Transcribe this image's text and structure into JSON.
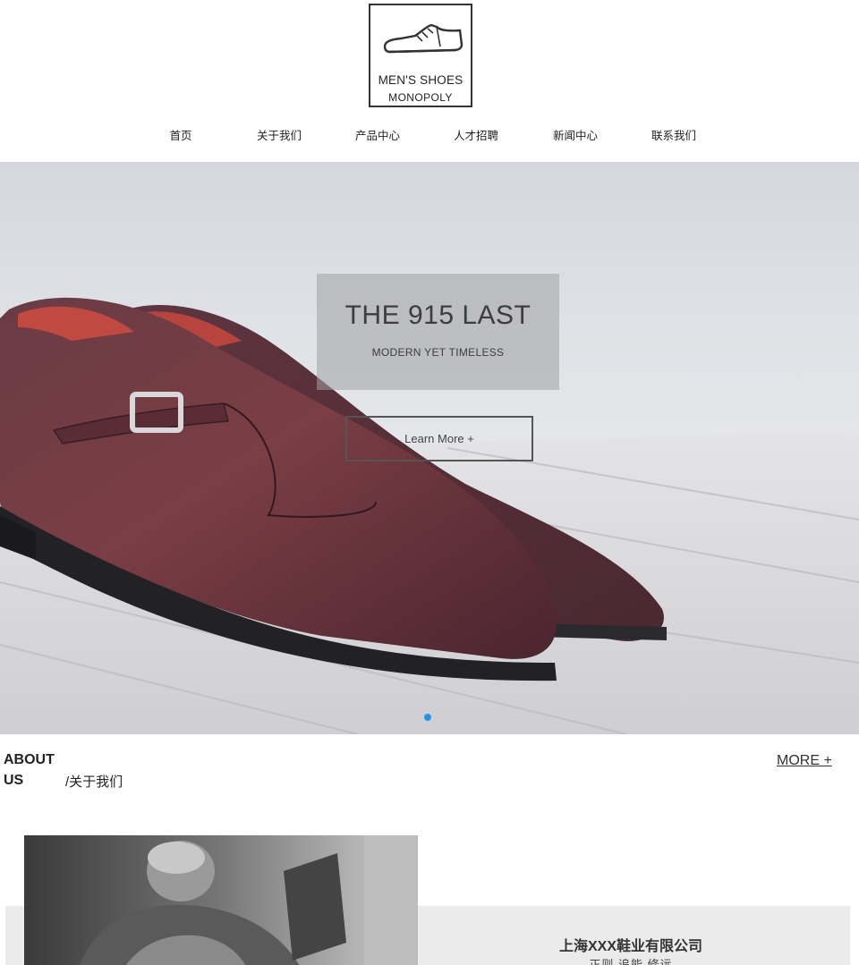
{
  "logo": {
    "line1": "MEN'S SHOES",
    "line2": "MONOPOLY"
  },
  "nav": {
    "items": [
      {
        "label": "首页"
      },
      {
        "label": "关于我们"
      },
      {
        "label": "产品中心"
      },
      {
        "label": "人才招聘"
      },
      {
        "label": "新闻中心"
      },
      {
        "label": "联系我们"
      }
    ]
  },
  "hero": {
    "title": "THE 915 LAST",
    "subtitle": "MODERN YET TIMELESS",
    "button_label": "Learn More +",
    "slide_count": 1,
    "active_slide": 1,
    "dot_color": "#1e96e6"
  },
  "about": {
    "heading": "ABOUT US",
    "subheading": "/关于我们",
    "more_label": "MORE +",
    "company_name": "上海XXX鞋业有限公司",
    "company_tagline": "正则 追能 修远"
  },
  "colors": {
    "accent": "#1e96e6",
    "band_gray": "#ebebeb",
    "text_dark": "#222222"
  }
}
